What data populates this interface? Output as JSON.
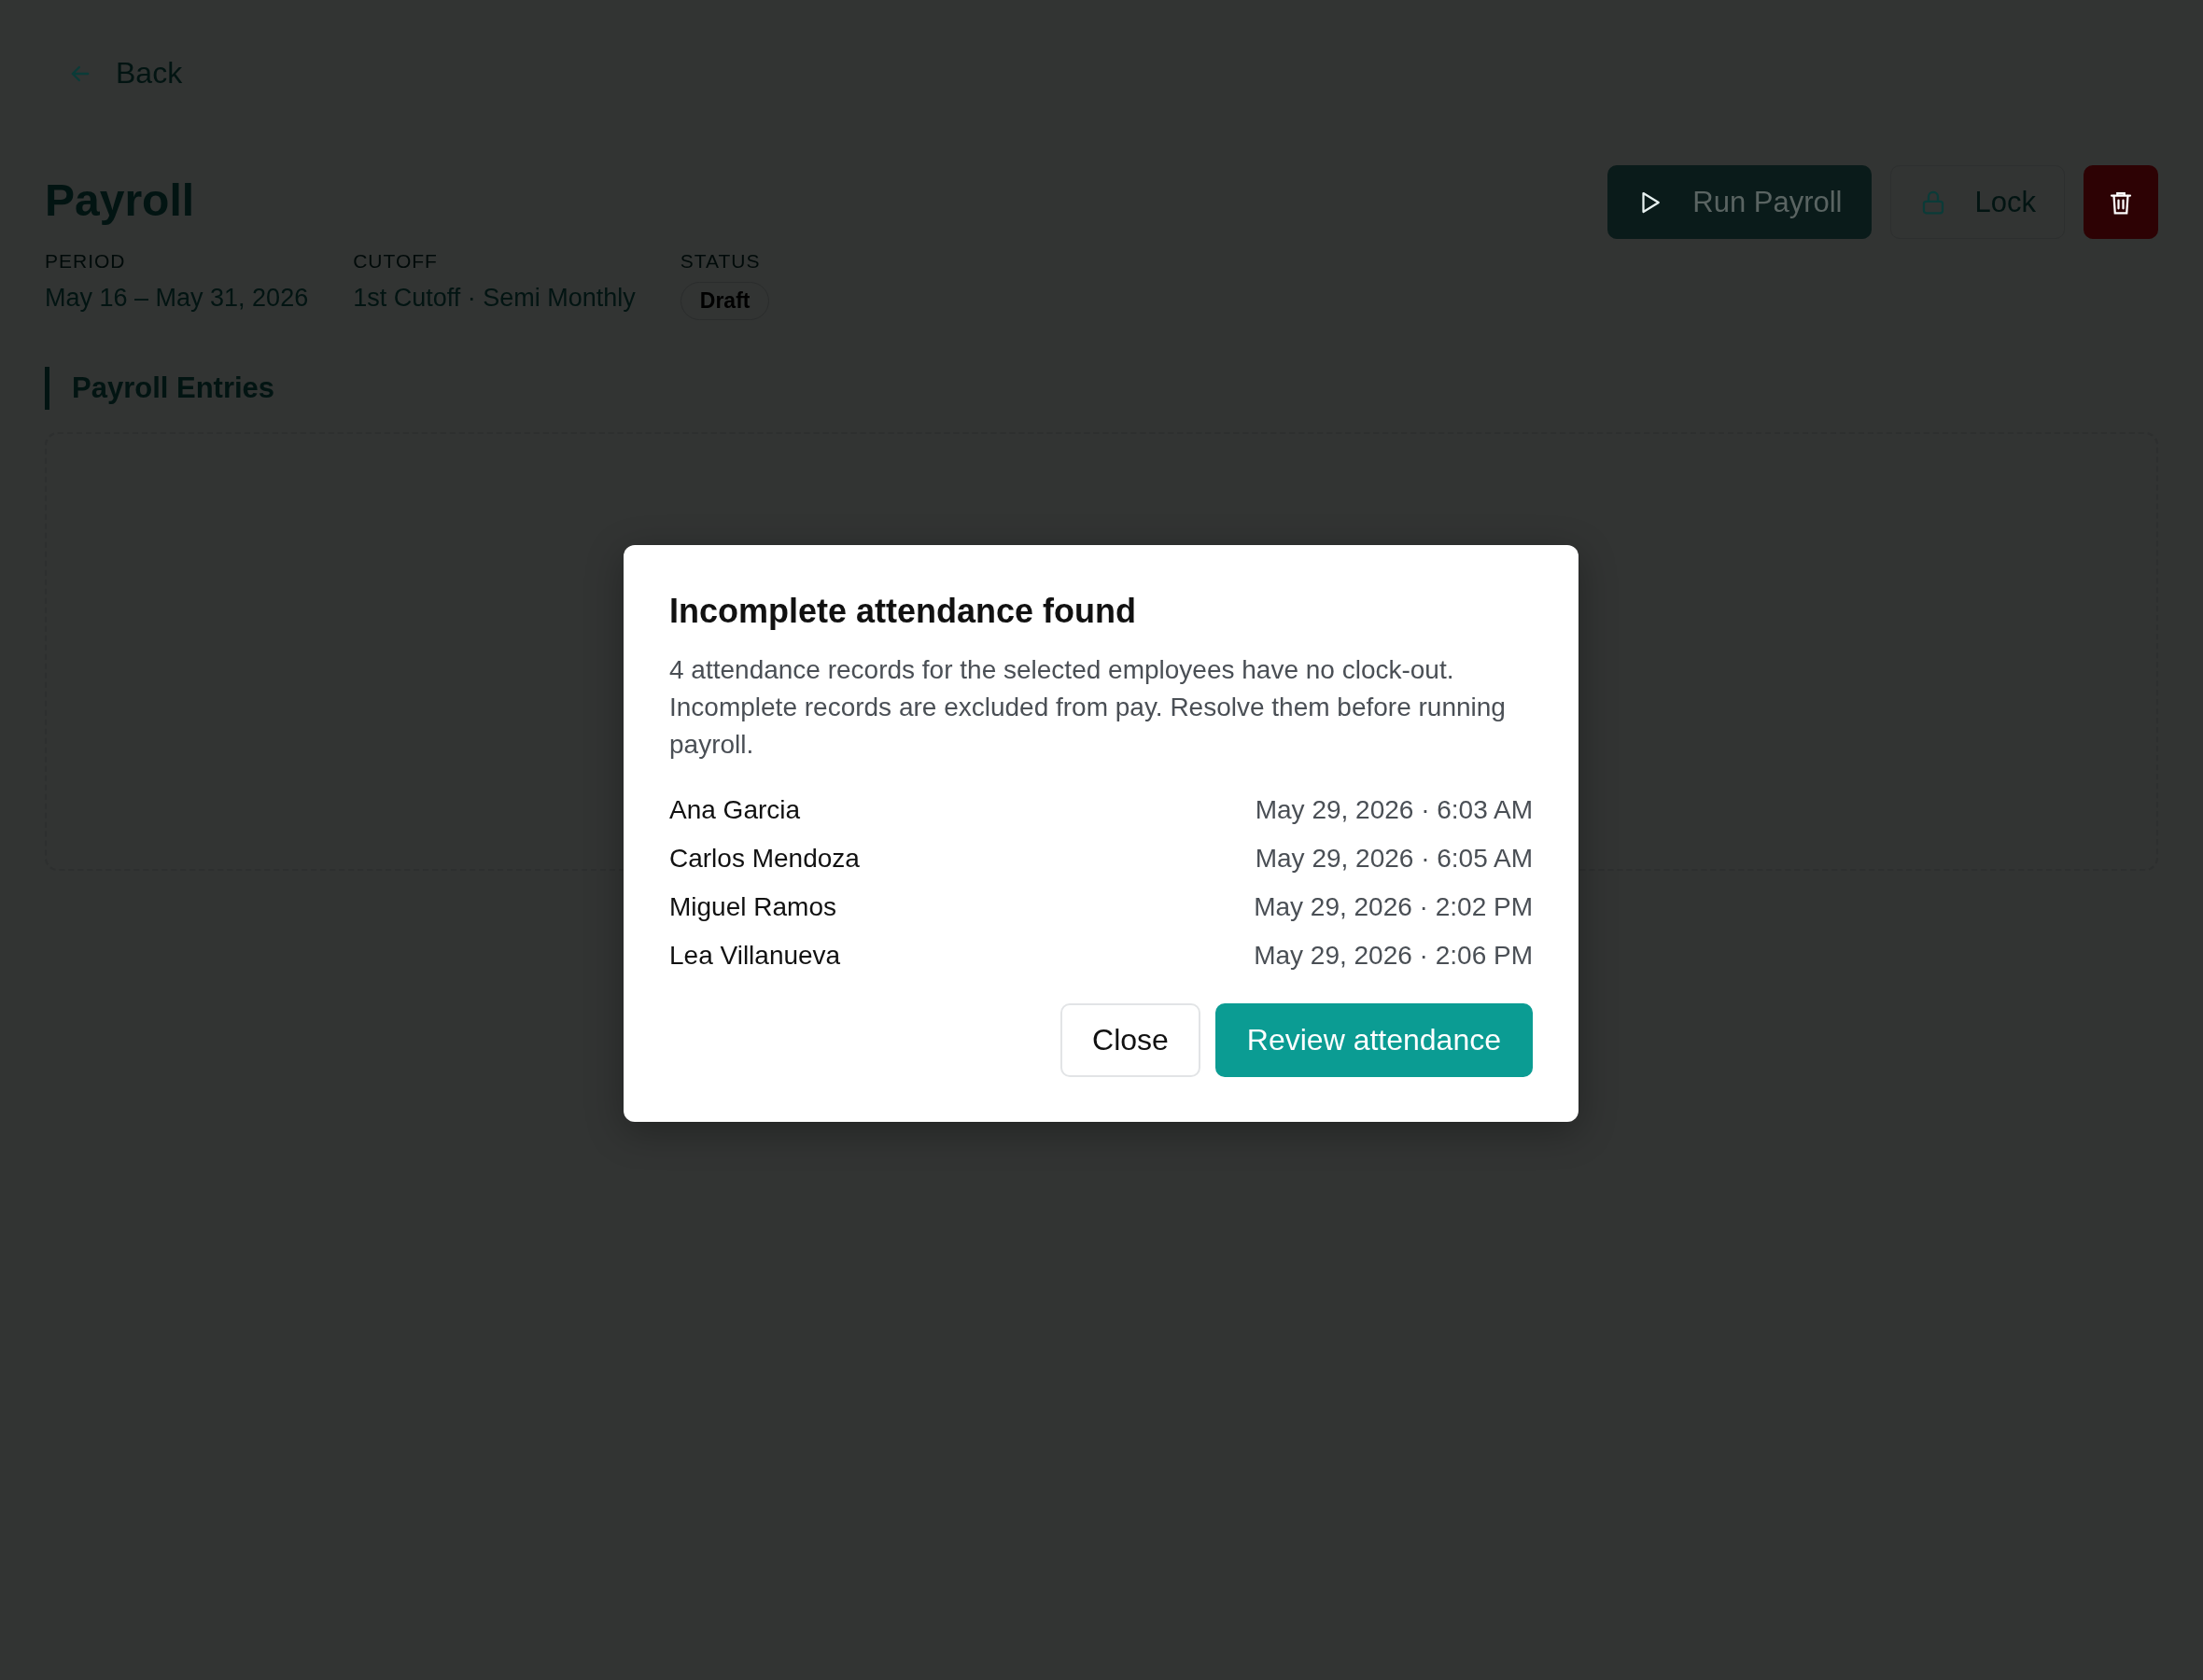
{
  "back_link": {
    "label": "Back"
  },
  "header": {
    "title": "Payroll",
    "meta": [
      {
        "kind": "text",
        "label": "PERIOD",
        "value": "May 16 – May 31, 2026"
      },
      {
        "kind": "text",
        "label": "CUTOFF",
        "value": "1st Cutoff · Semi Monthly"
      },
      {
        "kind": "badge",
        "label": "STATUS",
        "value": "Draft"
      }
    ],
    "actions": [
      {
        "kind": "primary",
        "label": "Run Payroll"
      },
      {
        "kind": "ghost",
        "label": "Lock"
      },
      {
        "kind": "danger"
      }
    ]
  },
  "section": {
    "title": "Payroll Entries"
  },
  "dialog": {
    "title": "Incomplete attendance found",
    "message": "4 attendance records for the selected employees have no clock-out. Incomplete records are excluded from pay. Resolve them before running payroll.",
    "records": [
      {
        "name": "Ana Garcia",
        "time": "May 29, 2026 · 6:03 AM"
      },
      {
        "name": "Carlos Mendoza",
        "time": "May 29, 2026 · 6:05 AM"
      },
      {
        "name": "Miguel Ramos",
        "time": "May 29, 2026 · 2:02 PM"
      },
      {
        "name": "Lea Villanueva",
        "time": "May 29, 2026 · 2:06 PM"
      }
    ],
    "buttons": [
      {
        "kind": "secondary",
        "label": "Close"
      },
      {
        "kind": "primary",
        "label": "Review attendance"
      }
    ]
  }
}
